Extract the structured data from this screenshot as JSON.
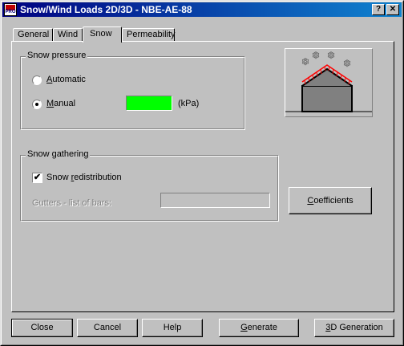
{
  "window": {
    "title": "Snow/Wind Loads 2D/3D - NBE-AE-88",
    "help_glyph": "?",
    "close_glyph": "✕",
    "app_icon_text": "PRO"
  },
  "tabs": [
    {
      "label": "General"
    },
    {
      "label": "Wind"
    },
    {
      "label": "Snow",
      "active": true
    },
    {
      "label": "Permeability"
    }
  ],
  "snow_pressure": {
    "group_label": "Snow pressure",
    "automatic_label": "Automatic",
    "manual_label": "Manual",
    "selected": "manual",
    "manual_value": "",
    "unit": "(kPa)",
    "field_color": "#00ff00"
  },
  "snow_gathering": {
    "group_label": "Snow gathering",
    "redistribution_label": "Snow redistribution",
    "redistribution_checked": true,
    "check_glyph": "✔",
    "gutters_label": "Gutters - list of bars:",
    "gutters_value": ""
  },
  "buttons": {
    "coefficients": "Coefficients",
    "close": "Close",
    "cancel": "Cancel",
    "help": "Help",
    "generate": "Generate",
    "generation_3d": "3D Generation"
  },
  "preview": {
    "snowflake_glyph": "❄",
    "roof_load_color": "#ff0000",
    "building_color": "#808080"
  }
}
